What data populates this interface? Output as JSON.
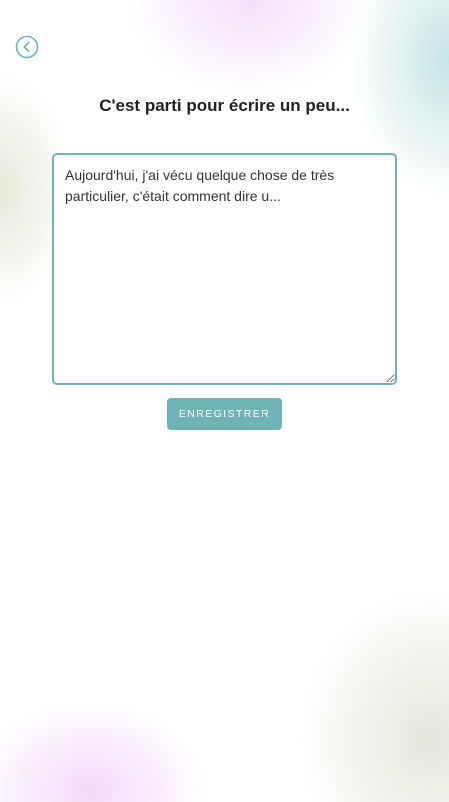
{
  "header": {
    "back_icon": "chevron-left-circle-icon",
    "title": "C'est parti pour écrire un peu..."
  },
  "editor": {
    "value": "Aujourd'hui, j'ai vécu quelque chose de très particulier, c'était comment dire u..."
  },
  "actions": {
    "save_label": "ENREGISTRER"
  },
  "colors": {
    "accent": "#6fb3b5",
    "title_text": "#222222",
    "body_text": "#333333"
  }
}
